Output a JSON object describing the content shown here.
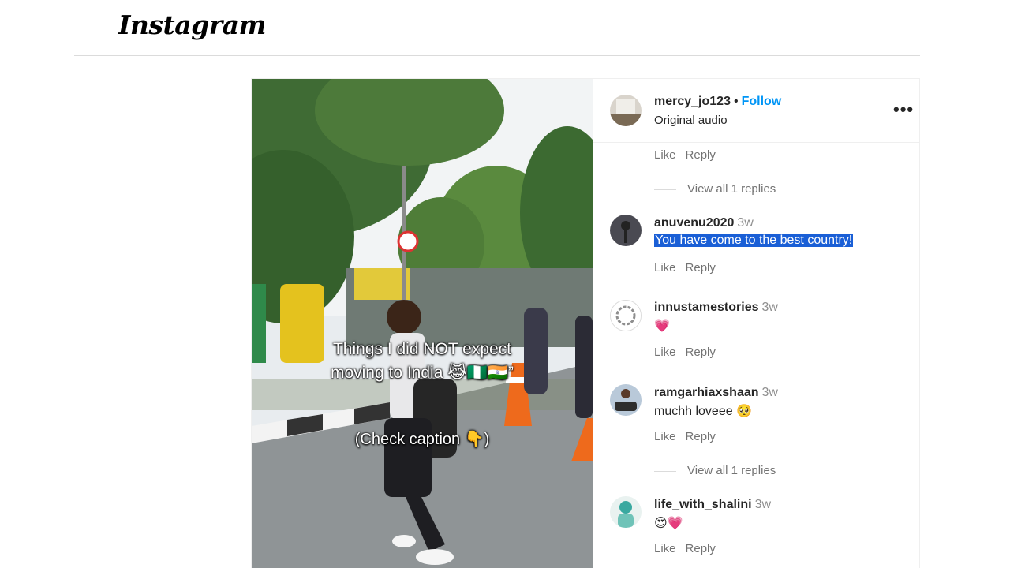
{
  "header": {
    "logo": "Instagram"
  },
  "post": {
    "username": "mercy_jo123",
    "separator": "•",
    "follow_label": "Follow",
    "audio": "Original audio",
    "more_label": "•••",
    "overlay_line1": "Things I did NOT expect",
    "overlay_line2": "moving to India 😹🇳🇬🇮🇳”",
    "overlay_sub": "(Check caption 👇)"
  },
  "comments": {
    "top_actions": {
      "like": "Like",
      "reply": "Reply"
    },
    "view_replies_1": "View all 1 replies",
    "items": [
      {
        "user": "anuvenu2020",
        "time": "3w",
        "text": "You have come to the best country!",
        "like": "Like",
        "reply": "Reply"
      },
      {
        "user": "innustamestories",
        "time": "3w",
        "text": "💗",
        "like": "Like",
        "reply": "Reply"
      },
      {
        "user": "ramgarhiaxshaan",
        "time": "3w",
        "text": "muchh loveee 🥺",
        "like": "Like",
        "reply": "Reply"
      },
      {
        "user": "life_with_shalini",
        "time": "3w",
        "text": "😍💗",
        "like": "Like",
        "reply": "Reply"
      }
    ],
    "view_replies_2": "View all 1 replies"
  },
  "colors": {
    "follow": "#0095f6",
    "selection": "#1a5fd6",
    "muted": "#737373"
  }
}
